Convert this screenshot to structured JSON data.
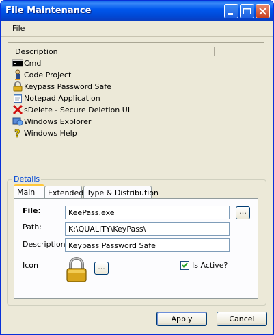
{
  "window": {
    "title": "File Maintenance"
  },
  "menu": {
    "file": "File"
  },
  "list": {
    "header": "Description",
    "items": [
      {
        "label": "Cmd",
        "icon": "cmd-icon"
      },
      {
        "label": "Code Project",
        "icon": "code-project-icon"
      },
      {
        "label": "Keypass Password Safe",
        "icon": "padlock-icon"
      },
      {
        "label": "Notepad Application",
        "icon": "notepad-icon"
      },
      {
        "label": "sDelete - Secure Deletion UI",
        "icon": "red-x-icon"
      },
      {
        "label": "Windows Explorer",
        "icon": "explorer-icon"
      },
      {
        "label": "Windows Help",
        "icon": "help-icon"
      }
    ]
  },
  "details": {
    "legend": "Details",
    "tabs": [
      "Main",
      "Extended",
      "Type & Distribution"
    ],
    "active_tab": "Main",
    "file_label": "File:",
    "file_value": "KeePass.exe",
    "path_label": "Path:",
    "path_value": "K:\\QUALITY\\KeyPass\\",
    "description_label": "Description:",
    "description_value": "Keypass Password Safe",
    "icon_label": "Icon",
    "browse_label": "...",
    "is_active_label": "Is Active?",
    "is_active": true
  },
  "buttons": {
    "apply": "Apply",
    "cancel": "Cancel"
  },
  "colors": {
    "title_blue": "#0058ee",
    "legend_blue": "#0046d5",
    "face": "#ece9d8"
  }
}
